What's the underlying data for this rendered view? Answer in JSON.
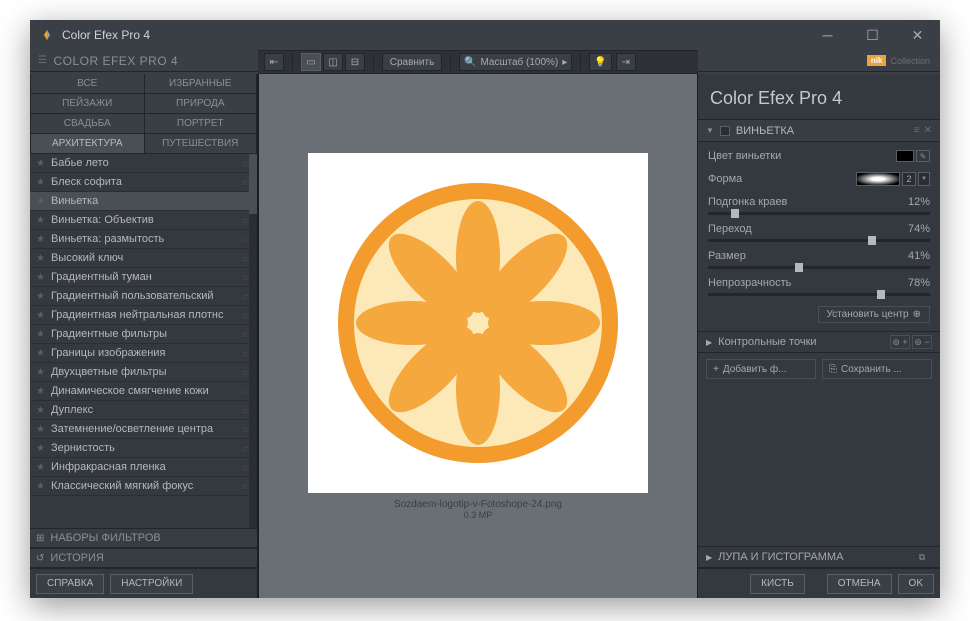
{
  "window": {
    "title": "Color Efex Pro 4"
  },
  "sidebar": {
    "title": "COLOR EFEX PRO 4",
    "categories": [
      "ВСЕ",
      "ИЗБРАННЫЕ",
      "ПЕЙЗАЖИ",
      "ПРИРОДА",
      "СВАДЬБА",
      "ПОРТРЕТ",
      "АРХИТЕКТУРА",
      "ПУТЕШЕСТВИЯ"
    ],
    "filters": [
      "Бабье лето",
      "Блеск софита",
      "Виньетка",
      "Виньетка: Объектив",
      "Виньетка: размытость",
      "Высокий ключ",
      "Градиентный туман",
      "Градиентный пользовательский",
      "Градиентная нейтральная плотнс",
      "Градиентные фильтры",
      "Границы изображения",
      "Двухцветные фильтры",
      "Динамическое смягчение кожи",
      "Дуплекс",
      "Затемнение/осветление центра",
      "Зернистость",
      "Инфракрасная пленка",
      "Классический мягкий фокус"
    ],
    "sets": "НАБОРЫ ФИЛЬТРОВ",
    "history": "ИСТОРИЯ"
  },
  "toolbar": {
    "compare": "Сравнить",
    "zoom": "Масштаб (100%)"
  },
  "canvas": {
    "filename": "Sozdaem-logotip-v-Fotoshope-24.png",
    "size": "0.3 MP"
  },
  "brand": {
    "nik": "nik",
    "collection": "Collection"
  },
  "product": {
    "name": "Color Efex Pro",
    "version": "4"
  },
  "panel": {
    "vignette": {
      "title": "ВИНЬЕТКА",
      "color_label": "Цвет виньетки",
      "shape_label": "Форма",
      "shape_value": "2",
      "sliders": [
        {
          "label": "Подгонка краев",
          "value": "12%",
          "pos": 12
        },
        {
          "label": "Переход",
          "value": "74%",
          "pos": 74
        },
        {
          "label": "Размер",
          "value": "41%",
          "pos": 41
        },
        {
          "label": "Непрозрачность",
          "value": "78%",
          "pos": 78
        }
      ],
      "center_btn": "Установить центр"
    },
    "control_points": {
      "title": "Контрольные точки",
      "add": "Добавить ф...",
      "save": "Сохранить ..."
    },
    "loupe": "ЛУПА И ГИСТОГРАММА"
  },
  "footer": {
    "help": "СПРАВКА",
    "settings": "НАСТРОЙКИ",
    "brush": "КИСТЬ",
    "cancel": "ОТМЕНА",
    "ok": "OK"
  }
}
